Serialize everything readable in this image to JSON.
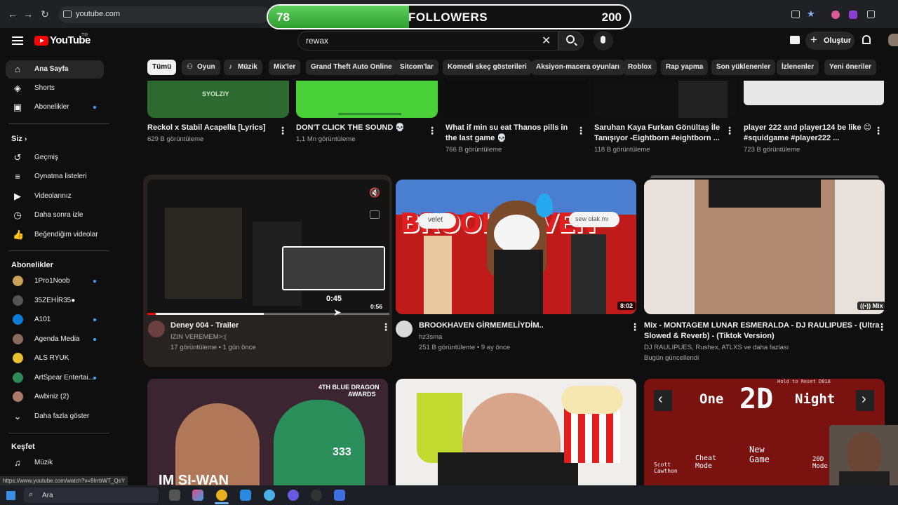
{
  "browser": {
    "url": "youtube.com",
    "back_icon": "arrow-left-icon",
    "forward_icon": "arrow-right-icon",
    "reload_icon": "reload-icon"
  },
  "overlay": {
    "current": "78",
    "label": "FOLLOWERS",
    "goal": "200",
    "progress_fraction": 0.39
  },
  "header": {
    "logo_text": "YouTube",
    "country_code": "TR",
    "search_value": "rewax",
    "create_label": "Oluştur"
  },
  "chips": [
    "Tümü",
    "Oyun",
    "Müzik",
    "Mix'ler",
    "Grand Theft Auto Online",
    "Sitcom'lar",
    "Komedi skeç gösterileri",
    "Aksiyon-macera oyunları",
    "Roblox",
    "Rap yapma",
    "Son yüklenenler",
    "İzlenenler",
    "Yeni öneriler"
  ],
  "sidebar": {
    "main": [
      {
        "label": "Ana Sayfa",
        "icon": "home-icon"
      },
      {
        "label": "Shorts",
        "icon": "shorts-icon"
      },
      {
        "label": "Abonelikler",
        "icon": "subscriptions-icon"
      }
    ],
    "you_heading": "Siz",
    "you": [
      {
        "label": "Geçmiş",
        "icon": "history-icon"
      },
      {
        "label": "Oynatma listeleri",
        "icon": "playlists-icon"
      },
      {
        "label": "Videolarınız",
        "icon": "your-videos-icon"
      },
      {
        "label": "Daha sonra izle",
        "icon": "watch-later-icon"
      },
      {
        "label": "Beğendiğim videolar",
        "icon": "like-icon"
      }
    ],
    "subs_heading": "Abonelikler",
    "subs": [
      {
        "label": "1Pro1Noob"
      },
      {
        "label": "35ZEHİR35●"
      },
      {
        "label": "A101"
      },
      {
        "label": "Agenda Media"
      },
      {
        "label": "ALS RYUK"
      },
      {
        "label": "ArtSpear Entertai..."
      },
      {
        "label": "Awbiniz (2)"
      }
    ],
    "show_more": "Daha fazla göster",
    "explore_heading": "Keşfet",
    "explore": [
      {
        "label": "Müzik",
        "icon": "music-icon"
      }
    ]
  },
  "row1": [
    {
      "title": "Reckol x Stabil Acapella [Lyrics]",
      "meta": "629 B görüntüleme",
      "thumb_text": "SYOLZIY"
    },
    {
      "title": "DON'T CLICK THE SOUND 💀",
      "meta": "1,1 Mn görüntüleme"
    },
    {
      "title": "What if min su eat Thanos pills in",
      "title2": "the last game 💀",
      "meta": "766 B görüntüleme"
    },
    {
      "title": "Saruhan Kaya  Furkan Gönültaş İle",
      "title2": "Tanışıyor -Eightborn #eightborn ...",
      "meta": "118 B görüntüleme"
    },
    {
      "title": "player 222 and player124 be like 😊",
      "title2": "#squidgame #player222 ...",
      "meta": "723 B görüntüleme"
    }
  ],
  "row2": [
    {
      "title": "Deney 004 - Trailer",
      "channel": "IZIN VEREMEM>:(",
      "meta": "17 görüntüleme • 1 gün önce",
      "hover_time": "0:45",
      "duration": "0:56",
      "progress_fraction": 0.48
    },
    {
      "title": "BROOKHAVEN GİRMEMELİYDİM..",
      "channel": "hz3sma",
      "meta": "251 B görüntüleme • 9 ay önce",
      "duration": "8:02",
      "bubble1": "velet",
      "bubble2": "sew olak mı",
      "thumb_text": "BROOKHAVEN"
    },
    {
      "title": "Mix - MONTAGEM LUNAR ESMERALDA - DJ RAULIPUES - (Ultra",
      "title2": "Slowed & Reverb) - (Tiktok Version)",
      "channel": "DJ RAULIPUES, Rushex, ATLXS ve daha fazlası",
      "meta": "Bugün güncellendi",
      "badge": "Mix"
    }
  ],
  "row3": [
    {
      "thumb_top": "4TH BLUE DRAGON",
      "thumb_top2": "AWARDS",
      "thumb_bottom": "IM SI-WAN",
      "jersey": "333"
    },
    {},
    {
      "game_title_left": "One",
      "game_title_big": "2D",
      "game_title_right": "Night",
      "menu_1": "Cheat Mode",
      "menu_2": "New Game",
      "menu_3": "20D Mode",
      "menu_4": "Scott Cawthon",
      "hint": "Hold to Reset D818"
    }
  ],
  "status_url": "https://www.youtube.com/watch?v=9IrrbWT_QsY",
  "taskbar": {
    "search_placeholder": "Ara"
  },
  "colors": {
    "accent_red": "#ff0000",
    "progress_red": "#ff0000",
    "followers_green": "#4cc24c",
    "subscribe_dot": "#3ea6ff"
  }
}
